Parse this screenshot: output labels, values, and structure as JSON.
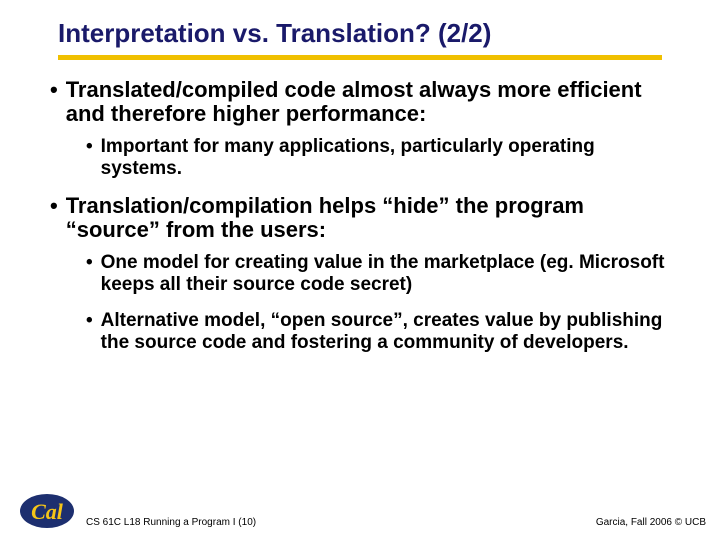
{
  "title": "Interpretation vs. Translation? (2/2)",
  "bullets": {
    "b1": "Translated/compiled code almost always more efficient and therefore higher performance:",
    "b1a": "Important for many applications, particularly operating systems.",
    "b2": "Translation/compilation helps “hide” the program “source” from the users:",
    "b2a": "One model for creating value in the marketplace (eg. Microsoft keeps all their source code secret)",
    "b2b": "Alternative model, “open source”, creates value by publishing the source code and fostering a community of developers."
  },
  "footer": {
    "left": "CS 61C L18 Running a Program I (10)",
    "right": "Garcia, Fall 2006 © UCB"
  }
}
